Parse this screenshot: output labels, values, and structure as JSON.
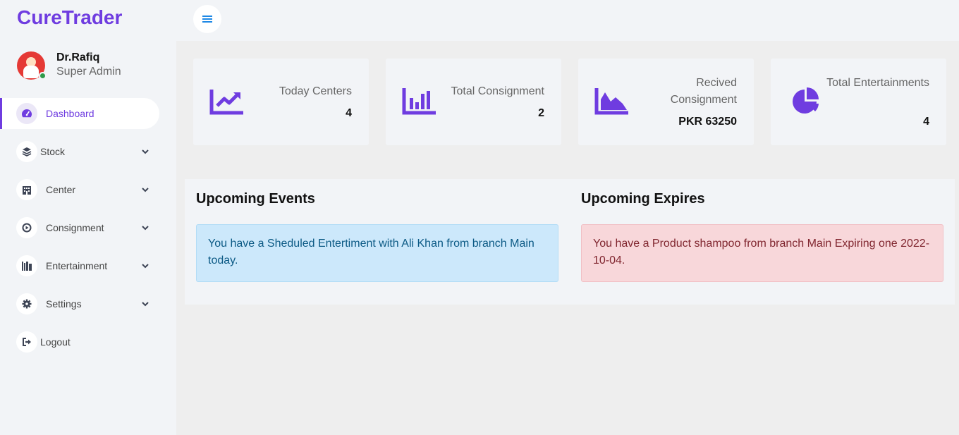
{
  "app": {
    "brand": "CureTrader"
  },
  "user": {
    "name": "Dr.Rafiq",
    "role": "Super Admin"
  },
  "sidebar": {
    "items": [
      {
        "label": "Dashboard",
        "icon": "gauge-icon",
        "active": true,
        "expandable": false
      },
      {
        "label": "Stock",
        "icon": "layers-icon",
        "expandable": true
      },
      {
        "label": "Center",
        "icon": "building-icon",
        "expandable": true
      },
      {
        "label": "Consignment",
        "icon": "play-circle-icon",
        "expandable": true
      },
      {
        "label": "Entertainment",
        "icon": "shelves-icon",
        "expandable": true
      },
      {
        "label": "Settings",
        "icon": "gear-icon",
        "expandable": true
      },
      {
        "label": "Logout",
        "icon": "logout-icon",
        "expandable": false
      }
    ]
  },
  "stats": [
    {
      "label": "Today Centers",
      "value": "4",
      "icon": "chart-line-icon"
    },
    {
      "label": "Total Consignment",
      "value": "2",
      "icon": "chart-bar-icon"
    },
    {
      "label": "Recived Consignment",
      "value": "PKR 63250",
      "icon": "chart-area-icon"
    },
    {
      "label": "Total Entertainments",
      "value": "4",
      "icon": "chart-pie-icon"
    }
  ],
  "events": {
    "title": "Upcoming Events",
    "message": "You have a Sheduled Entertiment with Ali Khan from branch Main today."
  },
  "expires": {
    "title": "Upcoming Expires",
    "message": "You have a Product shampoo from branch Main Expiring one 2022-10-04."
  },
  "colors": {
    "accent": "#6f3ce0",
    "info_bg": "#cce8fb",
    "danger_bg": "#f8d7da"
  }
}
